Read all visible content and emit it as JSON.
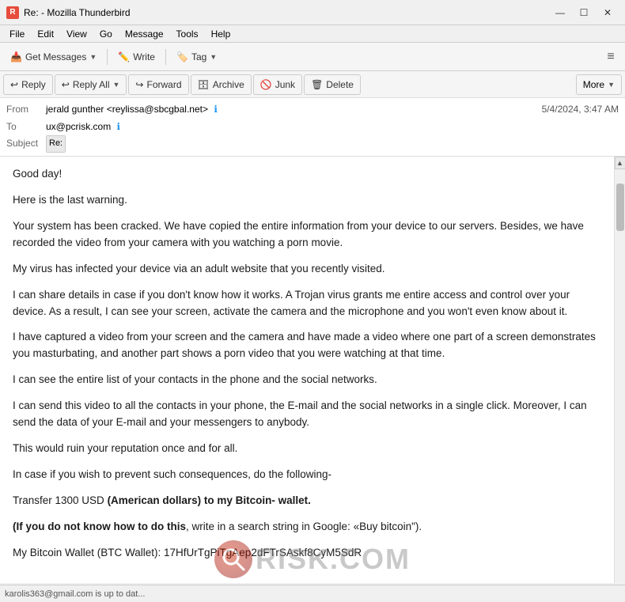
{
  "titlebar": {
    "icon_text": "R",
    "title": "Re: - Mozilla Thunderbird",
    "btn_min": "—",
    "btn_max": "☐",
    "btn_close": "✕"
  },
  "menubar": {
    "items": [
      "File",
      "Edit",
      "View",
      "Go",
      "Message",
      "Tools",
      "Help"
    ]
  },
  "toolbar": {
    "get_messages_label": "Get Messages",
    "write_label": "Write",
    "tag_label": "Tag",
    "hamburger": "≡"
  },
  "email_toolbar": {
    "reply_label": "Reply",
    "reply_all_label": "Reply All",
    "forward_label": "Forward",
    "archive_label": "Archive",
    "junk_label": "Junk",
    "delete_label": "Delete",
    "more_label": "More"
  },
  "email_meta": {
    "from_label": "From",
    "from_name": "jerald gunther <reylissa@sbcgbal.net>",
    "to_label": "To",
    "to_value": "ux@pcrisk.com",
    "subject_label": "Subject",
    "subject_re": "Re:",
    "date": "5/4/2024, 3:47 AM"
  },
  "email_body": {
    "p1": "Good day!",
    "p2": "Here is the last warning.",
    "p3": "Your system has been cracked. We have copied the entire information from your device to our servers. Besides, we have recorded the video from your camera with you watching a porn movie.",
    "p4": "My virus has infected your device via an adult website that you recently visited.",
    "p5": "I can share details in case if you don't know how it works. A Trojan virus grants me entire access and control over your device. As a result, I can see your screen, activate the camera and the microphone and you won't even know about it.",
    "p6": "I have captured a video from your screen and the camera and have made a video where one part of a screen demonstrates you masturbating, and another part shows a porn video that you were watching at that time.",
    "p7": "I can see the entire list of your contacts in the phone and the social networks.",
    "p8": "I can send this video to all the contacts in your phone, the E-mail and the social networks in a single click. Moreover, I can send the data of your E-mail and your messengers to anybody.",
    "p9": "This would ruin your reputation once and for all.",
    "p10": "In case if you wish to prevent such consequences, do the following-",
    "p11_normal": "Transfer 1300 USD ",
    "p11_bold": "(American dollars) to my Bitcoin- wallet.",
    "p12_start": "(If you do not know how to do this",
    "p12_end": ", write in a search string in Google: «Buy bitcoin\").",
    "p13_start": "My Bitcoin Wallet (BTC Wallet): 17HfUrTgPiTgAep2dFTrSAskf8CyM5SdR"
  },
  "statusbar": {
    "text": "karolis363@gmail.com is up to dat..."
  },
  "watermark": {
    "text": "RISK.COM"
  }
}
